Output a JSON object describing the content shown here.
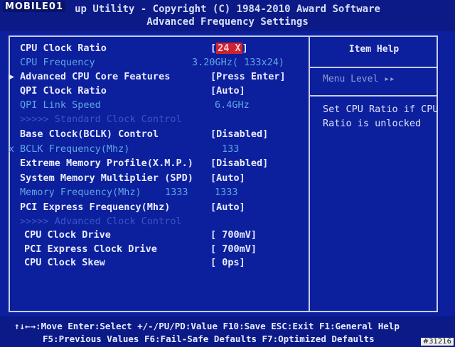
{
  "watermark": "MOBILE01",
  "header": {
    "line1": "up Utility - Copyright (C) 1984-2010 Award Software",
    "line2": "Advanced Frequency Settings"
  },
  "help": {
    "title": "Item Help",
    "menu_level": "Menu Level  ▸▸",
    "text": "Set CPU Ratio if CPU Ratio is unlocked"
  },
  "settings": [
    {
      "label": "CPU Clock Ratio",
      "value": "24 X",
      "open": "[",
      "close": "]"
    },
    {
      "label": "CPU Frequency",
      "value": "3.20GHz( 133x24)"
    },
    {
      "prefix": "▶",
      "label": "Advanced CPU Core Features",
      "value": "[Press Enter]"
    },
    {
      "label": "QPI Clock Ratio",
      "value": "[Auto]"
    },
    {
      "label": "QPI Link Speed",
      "value": "6.4GHz"
    },
    {
      "label": ">>>>> Standard Clock Control"
    },
    {
      "label": "Base Clock(BCLK) Control",
      "value": "[Disabled]"
    },
    {
      "prefix": "x",
      "label": "BCLK Frequency(Mhz)",
      "value": "133"
    },
    {
      "label": "Extreme Memory Profile(X.M.P.)",
      "value": "[Disabled]"
    },
    {
      "label": "System Memory Multiplier (SPD)",
      "value": "[Auto]"
    },
    {
      "label": "Memory Frequency(Mhz)",
      "mid": "1333",
      "value": "1333"
    },
    {
      "label": "PCI Express Frequency(Mhz)",
      "value": "[Auto]"
    },
    {
      "label": ">>>>> Advanced Clock Control"
    },
    {
      "label": "CPU Clock Drive",
      "value": "[ 700mV]"
    },
    {
      "label": "PCI Express Clock Drive",
      "value": "[ 700mV]"
    },
    {
      "label": "CPU Clock Skew",
      "value": "[   0ps]"
    }
  ],
  "footer": {
    "line1": "↑↓←→:Move  Enter:Select  +/-/PU/PD:Value  F10:Save  ESC:Exit  F1:General Help",
    "line2": "F5:Previous Values  F6:Fail-Safe Defaults  F7:Optimized Defaults"
  },
  "badge": "#31216"
}
